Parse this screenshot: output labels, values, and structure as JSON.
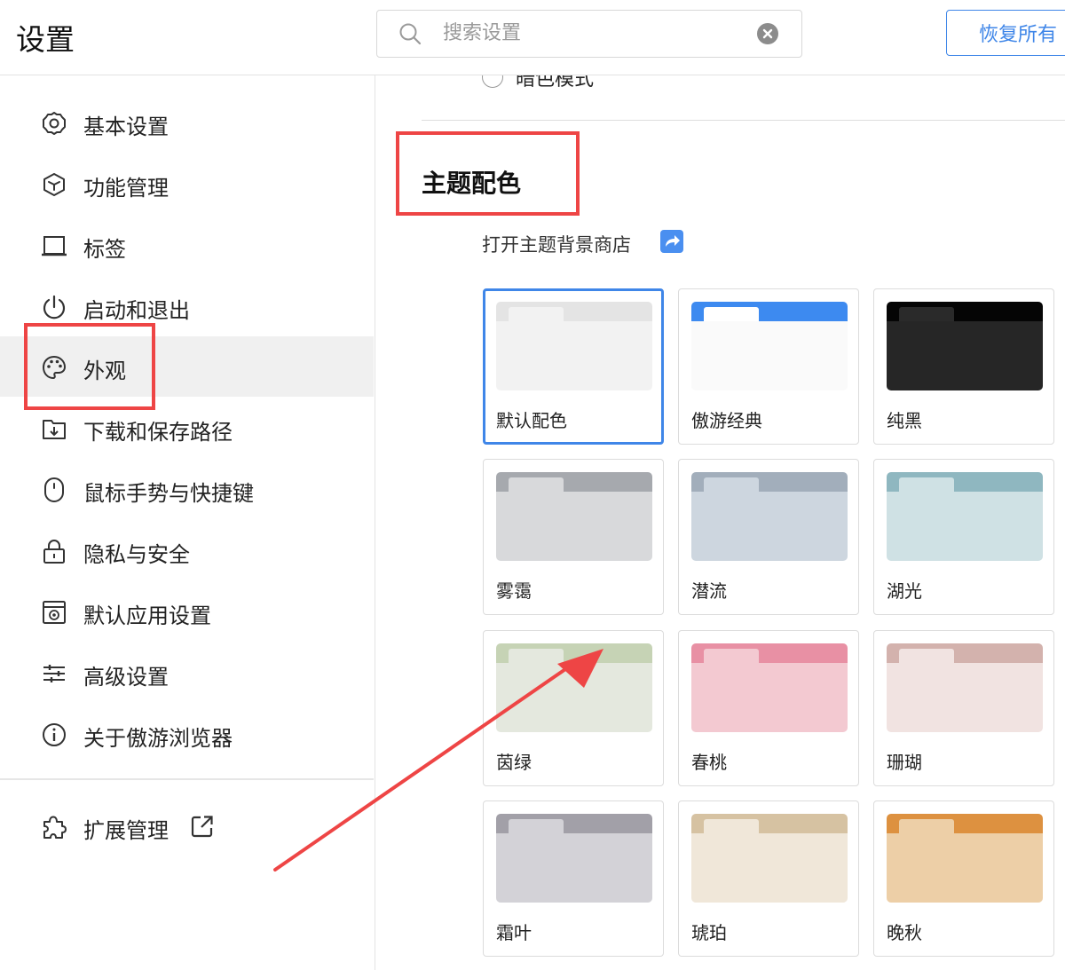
{
  "header": {
    "title": "设置",
    "search_placeholder": "搜索设置",
    "restore_button": "恢复所有"
  },
  "sidebar": {
    "items": [
      {
        "label": "基本设置",
        "icon": "gear-icon"
      },
      {
        "label": "功能管理",
        "icon": "cube-icon"
      },
      {
        "label": "标签",
        "icon": "tab-icon"
      },
      {
        "label": "启动和退出",
        "icon": "power-icon"
      },
      {
        "label": "外观",
        "icon": "palette-icon",
        "active": true
      },
      {
        "label": "下载和保存路径",
        "icon": "download-folder-icon"
      },
      {
        "label": "鼠标手势与快捷键",
        "icon": "mouse-icon"
      },
      {
        "label": "隐私与安全",
        "icon": "lock-icon"
      },
      {
        "label": "默认应用设置",
        "icon": "default-app-icon"
      },
      {
        "label": "高级设置",
        "icon": "sliders-icon"
      },
      {
        "label": "关于傲游浏览器",
        "icon": "info-icon"
      }
    ],
    "extensions": {
      "label": "扩展管理",
      "icon": "puzzle-icon",
      "link_icon": "external-link-icon"
    }
  },
  "main": {
    "dark_mode_label": "暗色模式",
    "section_title": "主题配色",
    "store_link": "打开主题背景商店",
    "themes": [
      {
        "name": "默认配色",
        "selected": true,
        "bar": "#e4e4e4",
        "tab": "#f2f2f2",
        "body": "#f2f2f2"
      },
      {
        "name": "傲游经典",
        "bar": "#3d8af0",
        "tab": "#ffffff",
        "body": "#fafafa"
      },
      {
        "name": "纯黑",
        "bar": "#050505",
        "tab": "#2a2a2a",
        "body": "#262626"
      },
      {
        "name": "雾霭",
        "bar": "#a6a9ae",
        "tab": "#d8d9db",
        "body": "#d8d9db"
      },
      {
        "name": "潜流",
        "bar": "#a2aebb",
        "tab": "#cdd6df",
        "body": "#cdd6df"
      },
      {
        "name": "湖光",
        "bar": "#8fb7c0",
        "tab": "#cfe1e4",
        "body": "#cfe1e4"
      },
      {
        "name": "茵绿",
        "bar": "#c6d3b5",
        "tab": "#e4e8de",
        "body": "#e4e8de"
      },
      {
        "name": "春桃",
        "bar": "#e890a4",
        "tab": "#f3c9d1",
        "body": "#f3c9d1"
      },
      {
        "name": "珊瑚",
        "bar": "#d3b2ad",
        "tab": "#f1e3e1",
        "body": "#f1e3e1"
      },
      {
        "name": "霜叶",
        "bar": "#a2a0a8",
        "tab": "#d3d2d7",
        "body": "#d3d2d7"
      },
      {
        "name": "琥珀",
        "bar": "#d6c2a2",
        "tab": "#f0e7d9",
        "body": "#f0e7d9"
      },
      {
        "name": "晚秋",
        "bar": "#dd9140",
        "tab": "#edcfa7",
        "body": "#edcfa7"
      }
    ]
  },
  "colors": {
    "accent": "#3f86e8",
    "annotation": "#ee4545"
  }
}
